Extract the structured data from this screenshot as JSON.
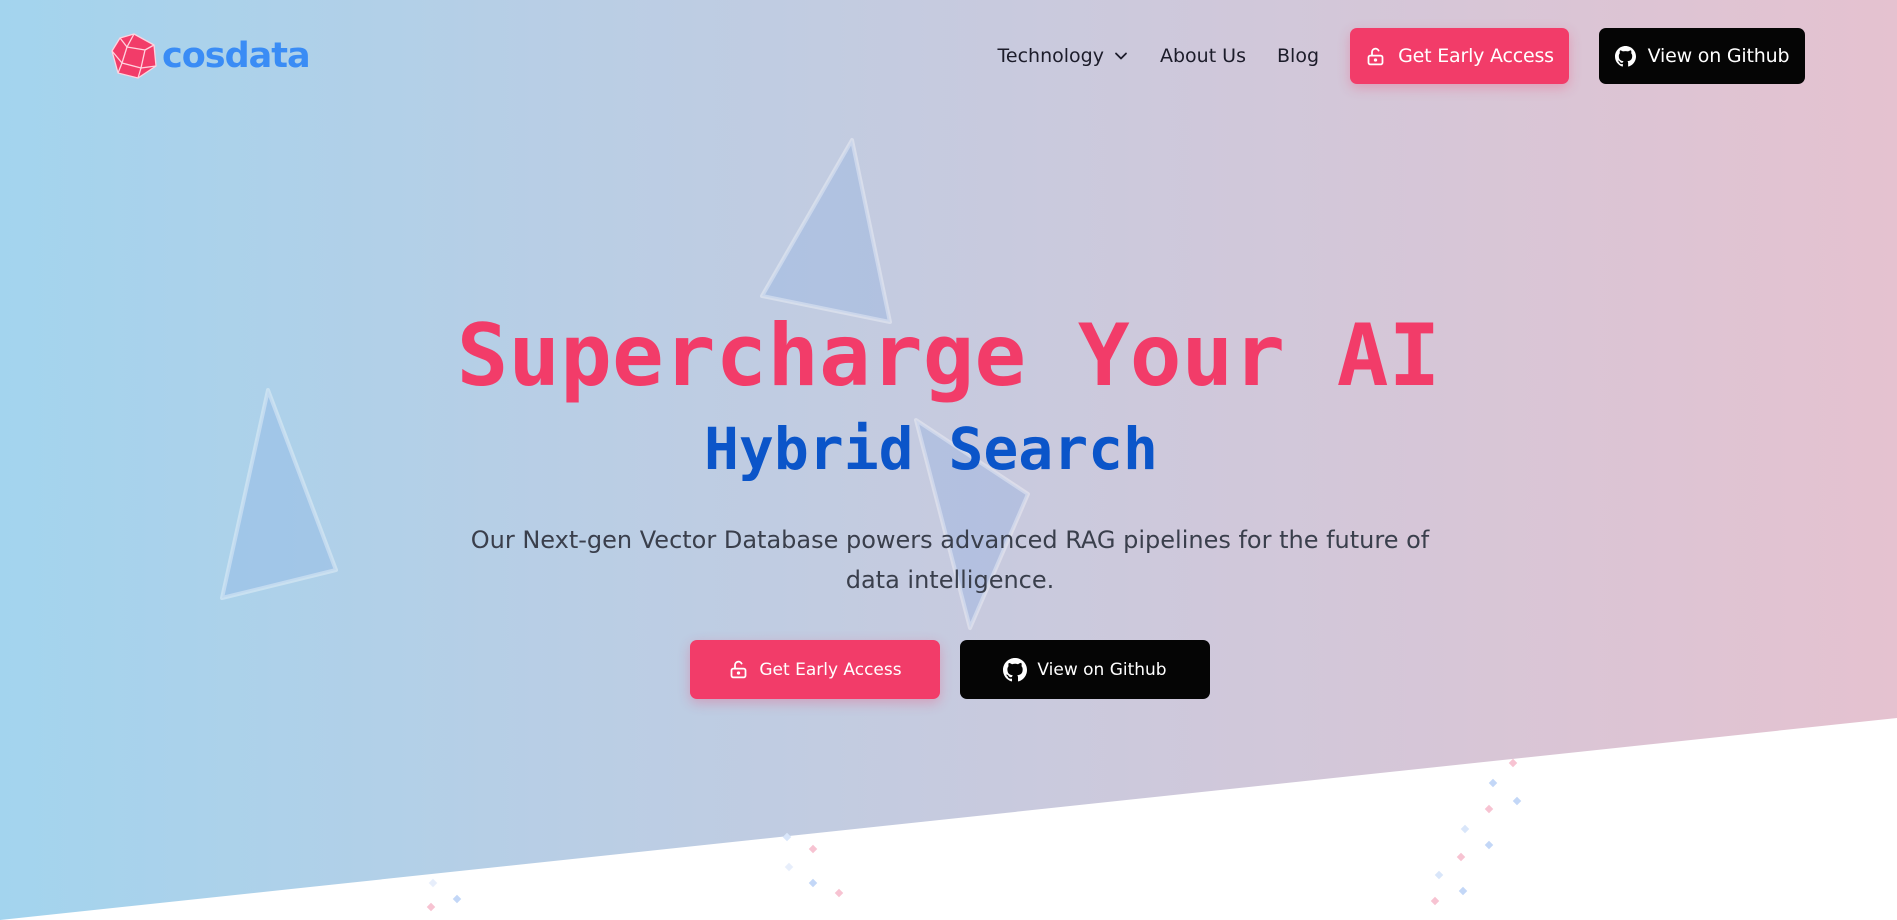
{
  "brand": {
    "name": "cosdata",
    "logo_icon": "polyhedron-icon",
    "colors": {
      "primary": "#f23c69",
      "logo_text": "#3a8cf5",
      "accent_blue": "#0b55c9",
      "dark": "#050505"
    }
  },
  "nav": {
    "items": [
      {
        "label": "Technology",
        "has_dropdown": true,
        "icon": "chevron-down-icon"
      },
      {
        "label": "About Us"
      },
      {
        "label": "Blog"
      }
    ],
    "early_access_label": "Get Early Access",
    "early_access_icon": "unlock-icon",
    "github_label": "View on Github",
    "github_icon": "github-icon"
  },
  "hero": {
    "headline": "Supercharge Your AI",
    "subheadline": "Hybrid Search",
    "description": "Our Next-gen Vector Database powers advanced RAG pipelines for the future of data intelligence.",
    "cta_primary": "Get Early Access",
    "cta_secondary": "View on Github"
  }
}
